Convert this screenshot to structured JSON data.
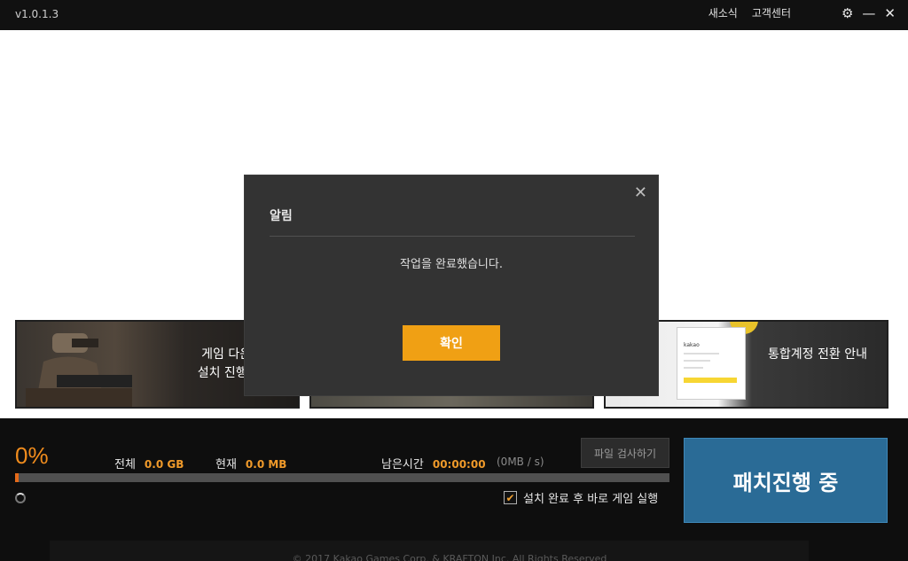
{
  "titlebar": {
    "version": "v1.0.1.3",
    "links": [
      "새소식",
      "고객센터"
    ]
  },
  "banners": [
    {
      "text": "게임 다운로\n설치 진행 관"
    },
    {
      "text": ""
    },
    {
      "text": "통합계정 전환 안내",
      "card_title": "kakao"
    }
  ],
  "progress": {
    "percent_label": "0%",
    "fraction": 0.006,
    "total_label": "전체",
    "total_value": "0.0 GB",
    "current_label": "현재",
    "current_value": "0.0 MB",
    "time_label": "남은시간",
    "time_value": "00:00:00",
    "speed": "(0MB / s)"
  },
  "buttons": {
    "file_check": "파일 검사하기",
    "patch": "패치진행 중"
  },
  "auto_run": {
    "checked": true,
    "label": "설치 완료 후 바로 게임 실행"
  },
  "footer": {
    "copyright": "© 2017 Kakao Games Corp. & KRAFTON Inc. All Rights Reserved"
  },
  "modal": {
    "title": "알림",
    "message": "작업을 완료했습니다.",
    "confirm": "확인"
  },
  "colors": {
    "accent_orange": "#f0a014",
    "patch_blue": "#2a6b96"
  }
}
